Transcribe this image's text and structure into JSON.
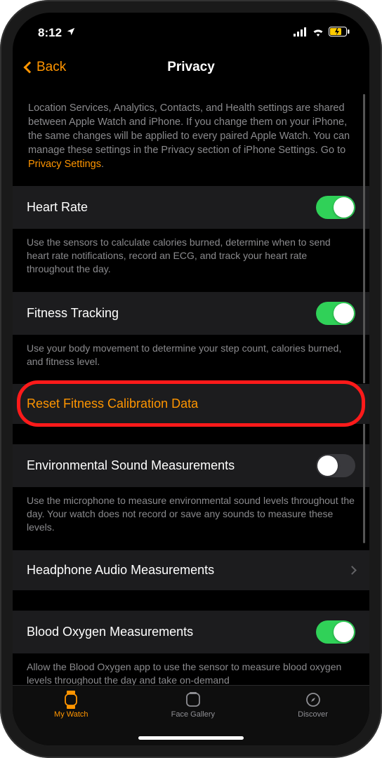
{
  "status": {
    "time": "8:12"
  },
  "nav": {
    "back": "Back",
    "title": "Privacy"
  },
  "intro": {
    "text": "Location Services, Analytics, Contacts, and Health settings are shared between Apple Watch and iPhone. If you change them on your iPhone, the same changes will be applied to every paired Apple Watch. You can manage these settings in the Privacy section of iPhone Settings. Go to ",
    "link": "Privacy Settings"
  },
  "rows": {
    "heartRate": {
      "label": "Heart Rate",
      "on": true,
      "footer": "Use the sensors to calculate calories burned, determine when to send heart rate notifications, record an ECG, and track your heart rate throughout the day."
    },
    "fitnessTracking": {
      "label": "Fitness Tracking",
      "on": true,
      "footer": "Use your body movement to determine your step count, calories burned, and fitness level."
    },
    "resetFitness": {
      "label": "Reset Fitness Calibration Data"
    },
    "envSound": {
      "label": "Environmental Sound Measurements",
      "on": false,
      "footer": "Use the microphone to measure environmental sound levels throughout the day. Your watch does not record or save any sounds to measure these levels."
    },
    "headphone": {
      "label": "Headphone Audio Measurements"
    },
    "bloodOxygen": {
      "label": "Blood Oxygen Measurements",
      "on": true,
      "footer": "Allow the Blood Oxygen app to use the sensor to measure blood oxygen levels throughout the day and take on-demand"
    }
  },
  "tabs": {
    "myWatch": "My Watch",
    "faceGallery": "Face Gallery",
    "discover": "Discover"
  }
}
